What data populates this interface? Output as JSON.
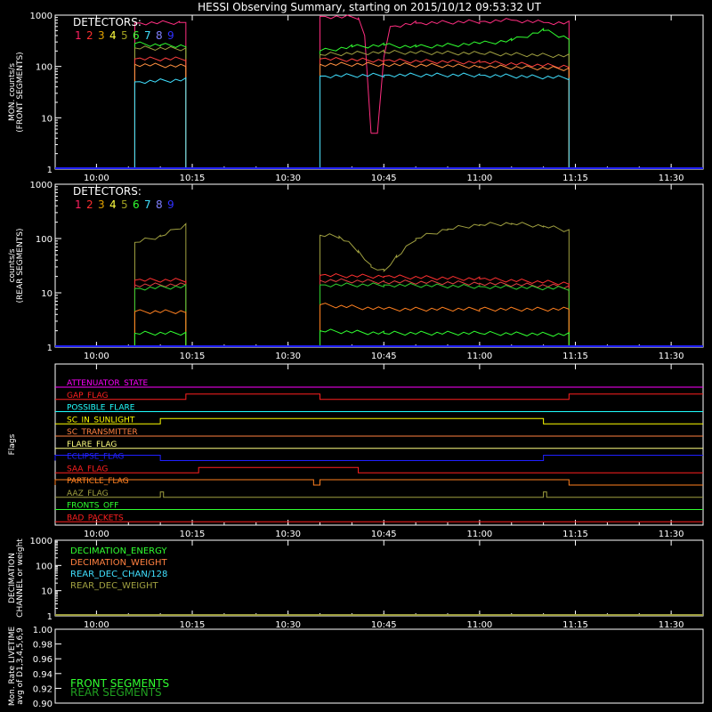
{
  "title": "HESSI Observing Summary, starting on 2015/10/12 09:53:32 UT",
  "colors": {
    "det": [
      "#ff2060",
      "#ff3030",
      "#e0a000",
      "#ffff40",
      "#a0a020",
      "#30ff30",
      "#40e0ff",
      "#8080ff",
      "#3030ff"
    ],
    "axis": "#ffffff",
    "front_top": "#ff2e80",
    "front_red": "#ff4040",
    "front_orange": "#ff9040",
    "front_green": "#30ff30",
    "front_olive": "#a0a040",
    "front_cyan": "#40e0ff",
    "rear_olive": "#a0a040",
    "rear_red": "#ff3030",
    "rear_red2": "#e04040",
    "rear_green": "#30d030",
    "rear_orange": "#ff8020",
    "rear_green_low": "#30ff30",
    "baseline": "#2020ff"
  },
  "chart_data": [
    {
      "type": "line",
      "title": "",
      "ylabel": "MON. counts/s\n(FRONT SEGMENTS)",
      "legend_title": "DETECTORS:",
      "legend": [
        "1",
        "2",
        "3",
        "4",
        "5",
        "6",
        "7",
        "8",
        "9"
      ],
      "yscale": "log",
      "ylim": [
        1,
        1000
      ],
      "yticks": [
        "1",
        "10",
        "100",
        "1000"
      ],
      "xlim": [
        "09:53:32",
        "11:35:00"
      ],
      "xticks": [
        "10:00",
        "10:15",
        "10:30",
        "10:45",
        "11:00",
        "11:15",
        "11:30"
      ],
      "series": [
        {
          "color_key": "front_top",
          "points": [
            [
              "10:06",
              700
            ],
            [
              "10:13",
              720
            ],
            [
              "10:14",
              720
            ],
            [
              "10:35",
              950
            ],
            [
              "10:41",
              900
            ],
            [
              "10:42",
              400
            ],
            [
              "10:43",
              5
            ],
            [
              "10:44",
              5
            ],
            [
              "10:45",
              150
            ],
            [
              "10:46",
              600
            ],
            [
              "10:50",
              700
            ],
            [
              "11:00",
              750
            ],
            [
              "11:05",
              800
            ],
            [
              "11:10",
              720
            ],
            [
              "11:14",
              700
            ]
          ]
        },
        {
          "color_key": "front_green",
          "points": [
            [
              "10:06",
              280
            ],
            [
              "10:10",
              260
            ],
            [
              "10:14",
              250
            ],
            [
              "10:35",
              200
            ],
            [
              "10:40",
              240
            ],
            [
              "10:45",
              260
            ],
            [
              "10:50",
              240
            ],
            [
              "11:00",
              280
            ],
            [
              "11:05",
              320
            ],
            [
              "11:10",
              500
            ],
            [
              "11:14",
              350
            ]
          ]
        },
        {
          "color_key": "front_olive",
          "points": [
            [
              "10:06",
              230
            ],
            [
              "10:14",
              220
            ],
            [
              "10:35",
              170
            ],
            [
              "10:45",
              190
            ],
            [
              "11:00",
              180
            ],
            [
              "11:14",
              160
            ]
          ]
        },
        {
          "color_key": "front_red",
          "points": [
            [
              "10:06",
              140
            ],
            [
              "10:14",
              140
            ],
            [
              "10:35",
              140
            ],
            [
              "10:45",
              130
            ],
            [
              "11:00",
              120
            ],
            [
              "11:14",
              100
            ]
          ]
        },
        {
          "color_key": "front_orange",
          "points": [
            [
              "10:06",
              110
            ],
            [
              "10:14",
              100
            ],
            [
              "10:35",
              110
            ],
            [
              "10:45",
              110
            ],
            [
              "11:00",
              100
            ],
            [
              "11:14",
              90
            ]
          ]
        },
        {
          "color_key": "front_cyan",
          "points": [
            [
              "10:06",
              50
            ],
            [
              "10:14",
              55
            ],
            [
              "10:35",
              65
            ],
            [
              "10:45",
              68
            ],
            [
              "11:00",
              68
            ],
            [
              "11:14",
              60
            ]
          ]
        }
      ],
      "data_gaps": [
        [
          "10:14",
          "10:35"
        ]
      ]
    },
    {
      "type": "line",
      "title": "",
      "ylabel": "counts/s\n(REAR SEGMENTS)",
      "legend_title": "DETECTORS:",
      "legend": [
        "1",
        "2",
        "3",
        "4",
        "5",
        "6",
        "7",
        "8",
        "9"
      ],
      "yscale": "log",
      "ylim": [
        1,
        1000
      ],
      "yticks": [
        "1",
        "10",
        "100",
        "1000"
      ],
      "xlim": [
        "09:53:32",
        "11:35:00"
      ],
      "xticks": [
        "10:00",
        "10:15",
        "10:30",
        "10:45",
        "11:00",
        "11:15",
        "11:30"
      ],
      "series": [
        {
          "color_key": "rear_olive",
          "points": [
            [
              "10:06",
              85
            ],
            [
              "10:10",
              110
            ],
            [
              "10:14",
              180
            ],
            [
              "10:35",
              115
            ],
            [
              "10:38",
              110
            ],
            [
              "10:41",
              60
            ],
            [
              "10:43",
              30
            ],
            [
              "10:45",
              25
            ],
            [
              "10:47",
              45
            ],
            [
              "10:50",
              100
            ],
            [
              "10:55",
              150
            ],
            [
              "11:00",
              180
            ],
            [
              "11:05",
              190
            ],
            [
              "11:10",
              170
            ],
            [
              "11:14",
              140
            ]
          ]
        },
        {
          "color_key": "rear_red",
          "points": [
            [
              "10:06",
              17
            ],
            [
              "10:14",
              17
            ],
            [
              "10:35",
              21
            ],
            [
              "10:45",
              20
            ],
            [
              "11:00",
              18
            ],
            [
              "11:14",
              15
            ]
          ]
        },
        {
          "color_key": "rear_red2",
          "points": [
            [
              "10:06",
              14
            ],
            [
              "10:14",
              14
            ],
            [
              "10:35",
              17
            ],
            [
              "10:45",
              16
            ],
            [
              "11:00",
              15
            ],
            [
              "11:14",
              13
            ]
          ]
        },
        {
          "color_key": "rear_green",
          "points": [
            [
              "10:06",
              12
            ],
            [
              "10:14",
              13
            ],
            [
              "10:35",
              14
            ],
            [
              "10:45",
              14
            ],
            [
              "11:00",
              13
            ],
            [
              "11:14",
              12
            ]
          ]
        },
        {
          "color_key": "rear_orange",
          "points": [
            [
              "10:06",
              4.5
            ],
            [
              "10:14",
              4.5
            ],
            [
              "10:35",
              6
            ],
            [
              "10:45",
              5
            ],
            [
              "11:00",
              5
            ],
            [
              "11:14",
              5
            ]
          ]
        },
        {
          "color_key": "rear_green_low",
          "points": [
            [
              "10:06",
              1.8
            ],
            [
              "10:14",
              1.8
            ],
            [
              "10:35",
              2
            ],
            [
              "10:45",
              1.8
            ],
            [
              "11:00",
              1.8
            ],
            [
              "11:14",
              1.7
            ]
          ]
        }
      ],
      "data_gaps": [
        [
          "10:14",
          "10:35"
        ]
      ]
    },
    {
      "type": "flags",
      "ylabel": "Flags",
      "xlim": [
        "09:53:32",
        "11:35:00"
      ],
      "xticks": [
        "10:00",
        "10:15",
        "10:30",
        "10:45",
        "11:00",
        "11:15",
        "11:30"
      ],
      "flags": [
        {
          "label": "ATTENUATOR_STATE",
          "color": "#ff00ff",
          "steps": []
        },
        {
          "label": "GAP_FLAG",
          "color": "#ff2020",
          "steps": [
            [
              "09:53:32",
              0
            ],
            [
              "10:14",
              1
            ],
            [
              "10:35",
              0
            ],
            [
              "11:14",
              1
            ]
          ]
        },
        {
          "label": "POSSIBLE_FLARE",
          "color": "#20ffff",
          "steps": []
        },
        {
          "label": "SC_IN_SUNLIGHT",
          "color": "#ffff00",
          "steps": [
            [
              "09:53:32",
              0
            ],
            [
              "10:10",
              1
            ],
            [
              "11:10",
              0
            ]
          ]
        },
        {
          "label": "SC_TRANSMITTER",
          "color": "#ff8040",
          "steps": []
        },
        {
          "label": "FLARE_FLAG",
          "color": "#ffff80",
          "steps": []
        },
        {
          "label": "ECLIPSE_FLAG",
          "color": "#2020ff",
          "steps": [
            [
              "09:53:32",
              1
            ],
            [
              "10:10",
              0
            ],
            [
              "11:10",
              1
            ]
          ]
        },
        {
          "label": "SAA_FLAG",
          "color": "#ff2020",
          "steps": [
            [
              "09:53:32",
              0
            ],
            [
              "10:16",
              1
            ],
            [
              "10:41",
              0
            ]
          ]
        },
        {
          "label": "PARTICLE_FLAG",
          "color": "#ff8020",
          "steps": [
            [
              "09:53:32",
              1
            ],
            [
              "10:34",
              0
            ],
            [
              "10:35",
              1
            ],
            [
              "11:14",
              0
            ]
          ]
        },
        {
          "label": "AAZ_FLAG",
          "color": "#a0a040",
          "steps": [
            [
              "09:53:32",
              0
            ],
            [
              "10:10",
              1
            ],
            [
              "10:10:30",
              0
            ],
            [
              "11:10",
              1
            ],
            [
              "11:10:30",
              0
            ]
          ]
        },
        {
          "label": "FRONTS_OFF",
          "color": "#30ff30",
          "steps": []
        },
        {
          "label": "BAD_PACKETS",
          "color": "#ff2020",
          "steps": []
        }
      ]
    },
    {
      "type": "line",
      "ylabel": "DECIMATION\nCHANNEL or weight",
      "yscale": "log",
      "ylim": [
        1,
        1000
      ],
      "yticks": [
        "1",
        "10",
        "100",
        "1000"
      ],
      "xlim": [
        "09:53:32",
        "11:35:00"
      ],
      "xticks": [
        "10:00",
        "10:15",
        "10:30",
        "10:45",
        "11:00",
        "11:15",
        "11:30"
      ],
      "legend": [
        {
          "label": "DECIMATION_ENERGY",
          "color": "#30ff30"
        },
        {
          "label": "DECIMATION_WEIGHT",
          "color": "#ff8040"
        },
        {
          "label": "REAR_DEC_CHAN/128",
          "color": "#40e0ff"
        },
        {
          "label": "REAR_DEC_WEIGHT",
          "color": "#a0a040"
        }
      ]
    },
    {
      "type": "line",
      "ylabel": "Mon. Rate LIVETIME\navg of D1,3,4,5,6,9",
      "ylim": [
        0.9,
        1.0
      ],
      "yticks": [
        "0.90",
        "0.92",
        "0.94",
        "0.96",
        "0.98",
        "1.00"
      ],
      "xlim": [
        "09:53:32",
        "11:35:00"
      ],
      "legend": [
        {
          "label": "FRONT SEGMENTS",
          "color": "#30ff30"
        },
        {
          "label": "REAR SEGMENTS",
          "color": "#20a020"
        }
      ]
    }
  ]
}
